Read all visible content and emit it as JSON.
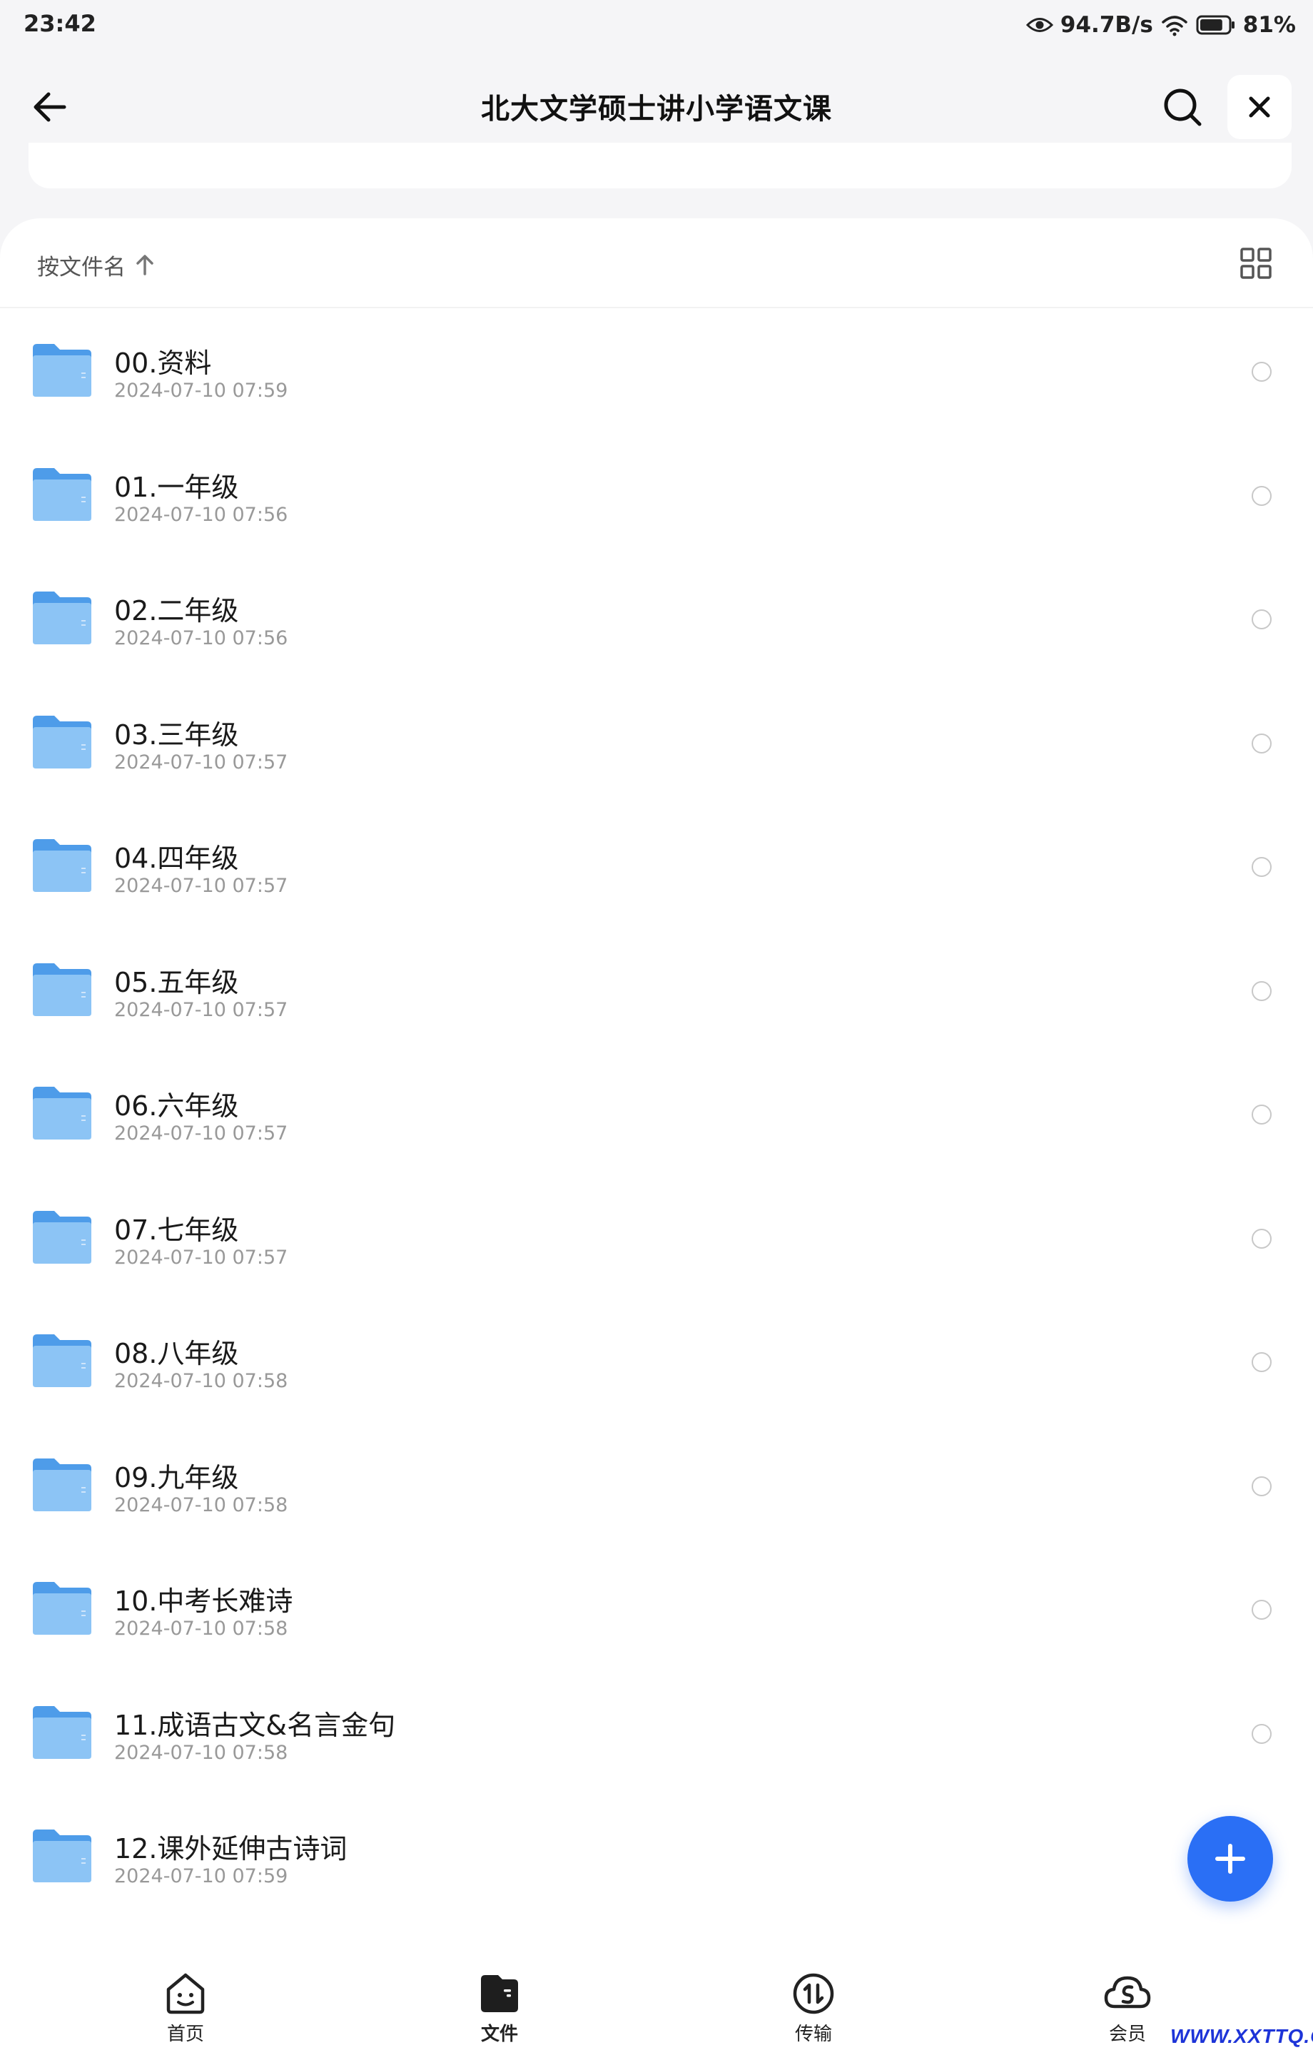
{
  "status_bar": {
    "time": "23:42",
    "net_speed": "94.7B/s",
    "battery": "81%",
    "battery_level": 0.81,
    "icons": [
      "eye-icon",
      "wifi-icon",
      "battery-icon"
    ]
  },
  "header": {
    "title": "北大文学硕士讲小学语文课",
    "icons": [
      "back-arrow-icon",
      "search-icon",
      "close-icon"
    ]
  },
  "sort": {
    "label": "按文件名",
    "direction_icon": "arrow-up-icon",
    "view_toggle_icon": "grid-icon"
  },
  "files": [
    {
      "name": "00.资料",
      "date": "2024-07-10 07:59"
    },
    {
      "name": "01.一年级",
      "date": "2024-07-10 07:56"
    },
    {
      "name": "02.二年级",
      "date": "2024-07-10 07:56"
    },
    {
      "name": "03.三年级",
      "date": "2024-07-10 07:57"
    },
    {
      "name": "04.四年级",
      "date": "2024-07-10 07:57"
    },
    {
      "name": "05.五年级",
      "date": "2024-07-10 07:57"
    },
    {
      "name": "06.六年级",
      "date": "2024-07-10 07:57"
    },
    {
      "name": "07.七年级",
      "date": "2024-07-10 07:57"
    },
    {
      "name": "08.八年级",
      "date": "2024-07-10 07:58"
    },
    {
      "name": "09.九年级",
      "date": "2024-07-10 07:58"
    },
    {
      "name": "10.中考长难诗",
      "date": "2024-07-10 07:58"
    },
    {
      "name": "11.成语古文&名言金句",
      "date": "2024-07-10 07:58"
    },
    {
      "name": "12.课外延伸古诗词",
      "date": "2024-07-10 07:59"
    }
  ],
  "fab": {
    "icon": "plus-icon"
  },
  "tabs": [
    {
      "label": "首页",
      "icon": "home-face-icon",
      "active": false
    },
    {
      "label": "文件",
      "icon": "folder-tab-icon",
      "active": true
    },
    {
      "label": "传输",
      "icon": "transfer-icon",
      "active": false
    },
    {
      "label": "会员",
      "icon": "vip-cloud-icon",
      "active": false
    }
  ],
  "watermark": "WWW.XXTTQ.COM",
  "colors": {
    "accent": "#2a6ff5",
    "folder": "#5aa5ee",
    "background": "#f5f5f7",
    "date_text": "#999999"
  }
}
